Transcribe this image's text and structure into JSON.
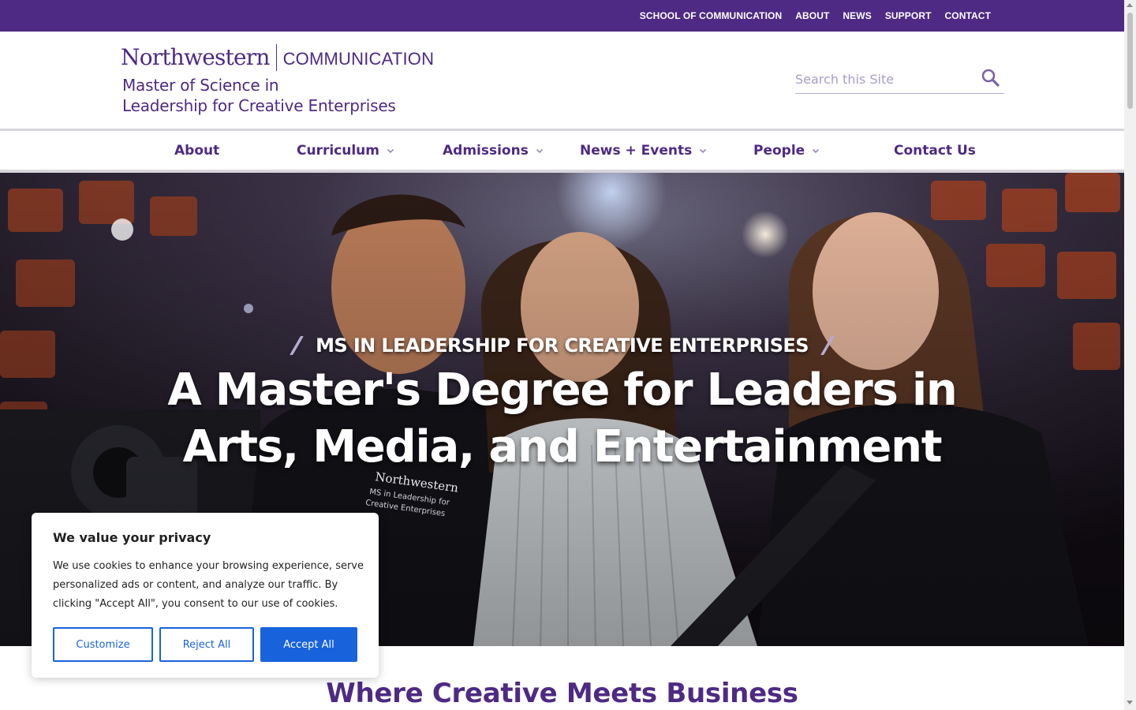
{
  "utility_nav": [
    "SCHOOL OF COMMUNICATION",
    "ABOUT",
    "NEWS",
    "SUPPORT",
    "CONTACT"
  ],
  "logo": {
    "university": "Northwestern",
    "school": "COMMUNICATION",
    "program_line1": "Master of Science in",
    "program_line2": "Leadership for Creative Enterprises"
  },
  "search": {
    "placeholder": "Search this Site",
    "icon": "magnifier-icon"
  },
  "main_nav": [
    {
      "label": "About",
      "has_dropdown": false
    },
    {
      "label": "Curriculum",
      "has_dropdown": true
    },
    {
      "label": "Admissions",
      "has_dropdown": true
    },
    {
      "label": "News + Events",
      "has_dropdown": true
    },
    {
      "label": "People",
      "has_dropdown": true
    },
    {
      "label": "Contact Us",
      "has_dropdown": false
    }
  ],
  "hero": {
    "kicker": "MS IN LEADERSHIP FOR CREATIVE ENTERPRISES",
    "title_line1": "A Master's Degree for Leaders in",
    "title_line2": "Arts, Media, and Entertainment",
    "shirt_text": "Northwestern",
    "shirt_sub1": "MS in Leadership for",
    "shirt_sub2": "Creative Enterprises"
  },
  "section_heading": "Where Creative Meets Business",
  "cookie_banner": {
    "title": "We value your privacy",
    "text": "We use cookies to enhance your browsing experience, serve personalized ads or content, and analyze our traffic. By clicking \"Accept All\", you consent to our use of cookies.",
    "buttons": {
      "customize": "Customize",
      "reject": "Reject All",
      "accept": "Accept All"
    }
  },
  "colors": {
    "brand_purple": "#4e2a84",
    "light_purple": "#b6acd1",
    "cookie_blue": "#1863dc"
  }
}
